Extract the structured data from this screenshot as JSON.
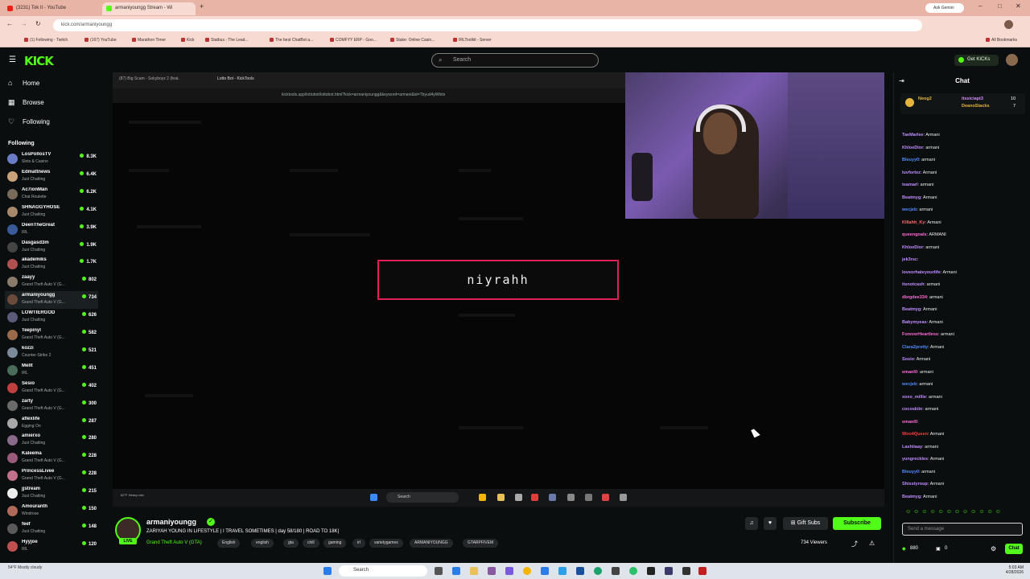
{
  "browser": {
    "tabs": [
      "(3231) Tok It - YouTube",
      "armaniyoungg Stream - Wi"
    ],
    "url": "kick.com/armaniyoungg",
    "ask_label": "Ask Gemini",
    "bookmarks": [
      "(1) Following - Twitch",
      "(167) YouTube",
      "Marathon Timer",
      "Kick",
      "Statbus - The Lead...",
      "The best ChatBot a...",
      "COMFYY ERP - Goo...",
      "Stake: Online Casin...",
      "IRLToolkit - Server"
    ],
    "all_bookmarks": "All Bookmarks"
  },
  "kick": {
    "logo": "KICK",
    "search_placeholder": "Search",
    "get_kicks": "Get KICKs"
  },
  "sidebar": {
    "nav": [
      "Home",
      "Browse",
      "Following"
    ],
    "following_label": "Following",
    "channels": [
      {
        "name": "LosPollosTV",
        "category": "Slots & Casino",
        "viewers": "8.3K",
        "color": "#6a7cc6"
      },
      {
        "name": "Edmattnews",
        "category": "Just Chatting",
        "viewers": "6.4K",
        "color": "#c9a27a"
      },
      {
        "name": "Ac7ionMan",
        "category": "Chat Roulette",
        "viewers": "6.2K",
        "color": "#7a6a5a"
      },
      {
        "name": "SHNAGGYHOSE",
        "category": "Just Chatting",
        "viewers": "4.1K",
        "color": "#a8886a"
      },
      {
        "name": "DeenTheGreat",
        "category": "IRL",
        "viewers": "3.9K",
        "color": "#3a5a9a"
      },
      {
        "name": "Dasgasd3m",
        "category": "Just Chatting",
        "viewers": "1.9K",
        "color": "#444"
      },
      {
        "name": "akademiks",
        "category": "Just Chatting",
        "viewers": "1.7K",
        "color": "#b05050"
      },
      {
        "name": "zaayy",
        "category": "Grand Theft Auto V (G...",
        "viewers": "802",
        "color": "#8a7a6a"
      },
      {
        "name": "armaniyoungg",
        "category": "Grand Theft Auto V (G...",
        "viewers": "734",
        "color": "#6a4a3a"
      },
      {
        "name": "LOWTIERGOD",
        "category": "Just Chatting",
        "viewers": "626",
        "color": "#5a5a7a"
      },
      {
        "name": "Teepinyl",
        "category": "Grand Theft Auto V (G...",
        "viewers": "582",
        "color": "#9a6a4a"
      },
      {
        "name": "kozzi",
        "category": "Counter-Strike 2",
        "viewers": "521",
        "color": "#7a8a9a"
      },
      {
        "name": "Mellt",
        "category": "IRL",
        "viewers": "451",
        "color": "#4a6a5a"
      },
      {
        "name": "Sesio",
        "category": "Grand Theft Auto V (G...",
        "viewers": "402",
        "color": "#c04040"
      },
      {
        "name": "zarty",
        "category": "Grand Theft Auto V (G...",
        "viewers": "300",
        "color": "#6a6a6a"
      },
      {
        "name": "aflexlife",
        "category": "Egging On",
        "viewers": "287",
        "color": "#a8a8a8"
      },
      {
        "name": "amierxo",
        "category": "Just Chatting",
        "viewers": "280",
        "color": "#8a6a8a"
      },
      {
        "name": "Kaleema",
        "category": "Grand Theft Auto V (G...",
        "viewers": "228",
        "color": "#9a5a7a"
      },
      {
        "name": "PrincessLivee",
        "category": "Grand Theft Auto V (G...",
        "viewers": "228",
        "color": "#c0708a"
      },
      {
        "name": "jjstream",
        "category": "Just Chatting",
        "viewers": "215",
        "color": "#eeeeee"
      },
      {
        "name": "Amouranth",
        "category": "Windrose",
        "viewers": "150",
        "color": "#b06a5a"
      },
      {
        "name": "feef",
        "category": "Just Chatting",
        "viewers": "148",
        "color": "#5a5a5a"
      },
      {
        "name": "Hyyjoe",
        "category": "IRL",
        "viewers": "120",
        "color": "#c05050"
      }
    ]
  },
  "video": {
    "inner_tabs": [
      "(87) Big Scam - Sokyboyz 2 (feat.",
      "Lotto Bot - KickTools"
    ],
    "inner_url": "kicktools.app/lottobot/lottobot.html?kick=armaniyoungg&keyword=armani&id=Tbyud4yWhits",
    "overlay_name": "niyrahh",
    "weather": "62°F Heavy rain",
    "search": "Search"
  },
  "stream_info": {
    "live": "LIVE",
    "username": "armaniyoungg",
    "title": "ZARIYAH YOUNG IN LIFESTYLE | I TRAVEL SOMETIMES | day 58/180 | ROAD TO 18K|",
    "category": "Grand Theft Auto V (GTA)",
    "tags": [
      "English",
      "english",
      "gta",
      "chill",
      "gaming",
      "irl",
      "varietygames",
      "ARMANIYOUNGG",
      "GTARPFIVEM"
    ],
    "gift_subs": "Gift Subs",
    "subscribe": "Subscribe",
    "viewers": "734 Viewers"
  },
  "chat": {
    "title": "Chat",
    "pinned": [
      {
        "user": "Neog2",
        "text": "",
        "color": "#e7b53c"
      },
      {
        "user": "itssiciapt3",
        "text": "10",
        "color": "#d28cff"
      },
      {
        "user": "DeanoStacks",
        "text": "7",
        "color": "#e7b53c"
      }
    ],
    "messages": [
      {
        "user": "TaeMarlee",
        "text": "Armani",
        "color": "#c08cff"
      },
      {
        "user": "KhloeDior",
        "text": "armani",
        "color": "#c08cff"
      },
      {
        "user": "Bleuyy0",
        "text": "armani",
        "color": "#4f8cff"
      },
      {
        "user": "luvfortez",
        "text": "Armani",
        "color": "#c08cff"
      },
      {
        "user": "teamarl",
        "text": "armani",
        "color": "#c08cff"
      },
      {
        "user": "Beatmyg",
        "text": "Armani",
        "color": "#c08cff"
      },
      {
        "user": "wecjeb",
        "text": "armani",
        "color": "#4f8cff"
      },
      {
        "user": "Klllahh_Ky",
        "text": "Armani",
        "color": "#ff6b6b"
      },
      {
        "user": "queengoals",
        "text": "ARMANI",
        "color": "#ff6bd8"
      },
      {
        "user": "KhloeDior",
        "text": "armani",
        "color": "#c08cff"
      },
      {
        "user": "jek3rsc",
        "text": "",
        "color": "#c08cff"
      },
      {
        "user": "loveorhateyourlife",
        "text": "Armani",
        "color": "#c08cff"
      },
      {
        "user": "itsnotcash",
        "text": "armani",
        "color": "#c08cff"
      },
      {
        "user": "dbrgdee334",
        "text": "armani",
        "color": "#ff6bd8"
      },
      {
        "user": "Beatmyg",
        "text": "Armani",
        "color": "#c08cff"
      },
      {
        "user": "Babymyeas",
        "text": "Armani",
        "color": "#c08cff"
      },
      {
        "user": "ForeverHeartless",
        "text": "armani",
        "color": "#ff6bd8"
      },
      {
        "user": "Clara2pretty",
        "text": "Armani",
        "color": "#4f8cff"
      },
      {
        "user": "Sosio",
        "text": "Armani",
        "color": "#c08cff"
      },
      {
        "user": "emanl0",
        "text": "armani",
        "color": "#ff6bd8"
      },
      {
        "user": "wecjeb",
        "text": "armani",
        "color": "#4f8cff"
      },
      {
        "user": "xoxo_millie",
        "text": "armani",
        "color": "#c08cff"
      },
      {
        "user": "cocoskiin",
        "text": "armani",
        "color": "#c08cff"
      },
      {
        "user": "emanl0",
        "text": "",
        "color": "#ff6bd8"
      },
      {
        "user": "Woo4Queen",
        "text": "Armani",
        "color": "#ff3b3b"
      },
      {
        "user": "Lashiiaay",
        "text": "armani",
        "color": "#c08cff"
      },
      {
        "user": "yungreckles",
        "text": "Armani",
        "color": "#c08cff"
      },
      {
        "user": "Bleuyy0",
        "text": "armani",
        "color": "#4f8cff"
      },
      {
        "user": "Shisstyroup",
        "text": "Armani",
        "color": "#c08cff"
      },
      {
        "user": "Beatmyg",
        "text": "Armani",
        "color": "#c08cff"
      }
    ],
    "input_placeholder": "Send a message",
    "kicks_count": "880",
    "subs_count": "0",
    "chat_button": "Chat"
  },
  "os": {
    "search": "Search",
    "weather": "54°F Mostly cloudy",
    "time": "5:03 AM",
    "date": "4/28/2026"
  }
}
